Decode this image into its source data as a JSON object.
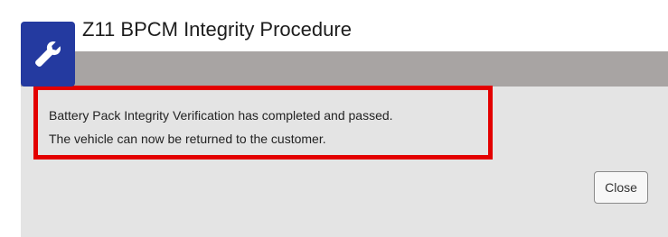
{
  "dialog": {
    "title": "Z11 BPCM Integrity Procedure",
    "icon": "wrench-icon",
    "accent_color": "#243aa0",
    "highlight_color": "#e30000",
    "message_lines": [
      "Battery Pack Integrity Verification has completed and passed.",
      "The vehicle can now be returned to the customer."
    ],
    "close_label": "Close"
  }
}
